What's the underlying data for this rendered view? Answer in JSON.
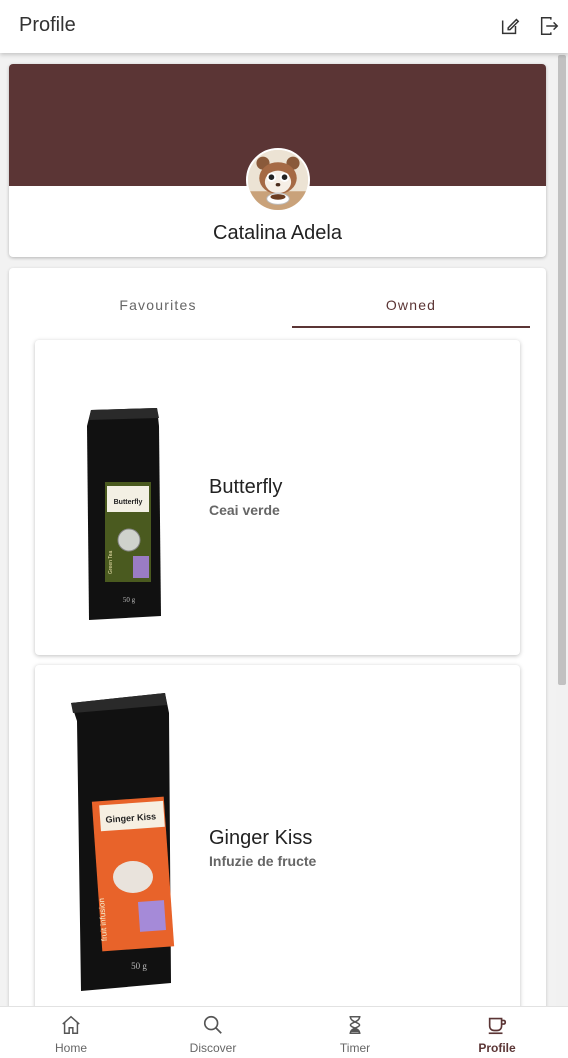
{
  "header": {
    "title": "Profile",
    "icons": [
      "edit-icon",
      "logout-icon"
    ]
  },
  "profile": {
    "name": "Catalina Adela",
    "banner_color": "#5b3535"
  },
  "tabs": [
    {
      "label": "Favourites",
      "active": false
    },
    {
      "label": "Owned",
      "active": true
    }
  ],
  "teas": [
    {
      "name": "Butterfly",
      "type": "Ceai verde",
      "label_title": "Butterfly",
      "side_text": "Green Tea",
      "weight": "50 g",
      "label_color": "#4a5a1f"
    },
    {
      "name": "Ginger Kiss",
      "type": "Infuzie de fructe",
      "label_title": "Ginger Kiss",
      "side_text": "fruit infusion",
      "weight": "50 g",
      "label_color": "#e8632a"
    }
  ],
  "bottom_nav": [
    {
      "label": "Home",
      "icon": "home-icon",
      "active": false
    },
    {
      "label": "Discover",
      "icon": "search-icon",
      "active": false
    },
    {
      "label": "Timer",
      "icon": "hourglass-icon",
      "active": false
    },
    {
      "label": "Profile",
      "icon": "tea-cup-icon",
      "active": true
    }
  ],
  "colors": {
    "accent": "#5b3535"
  }
}
